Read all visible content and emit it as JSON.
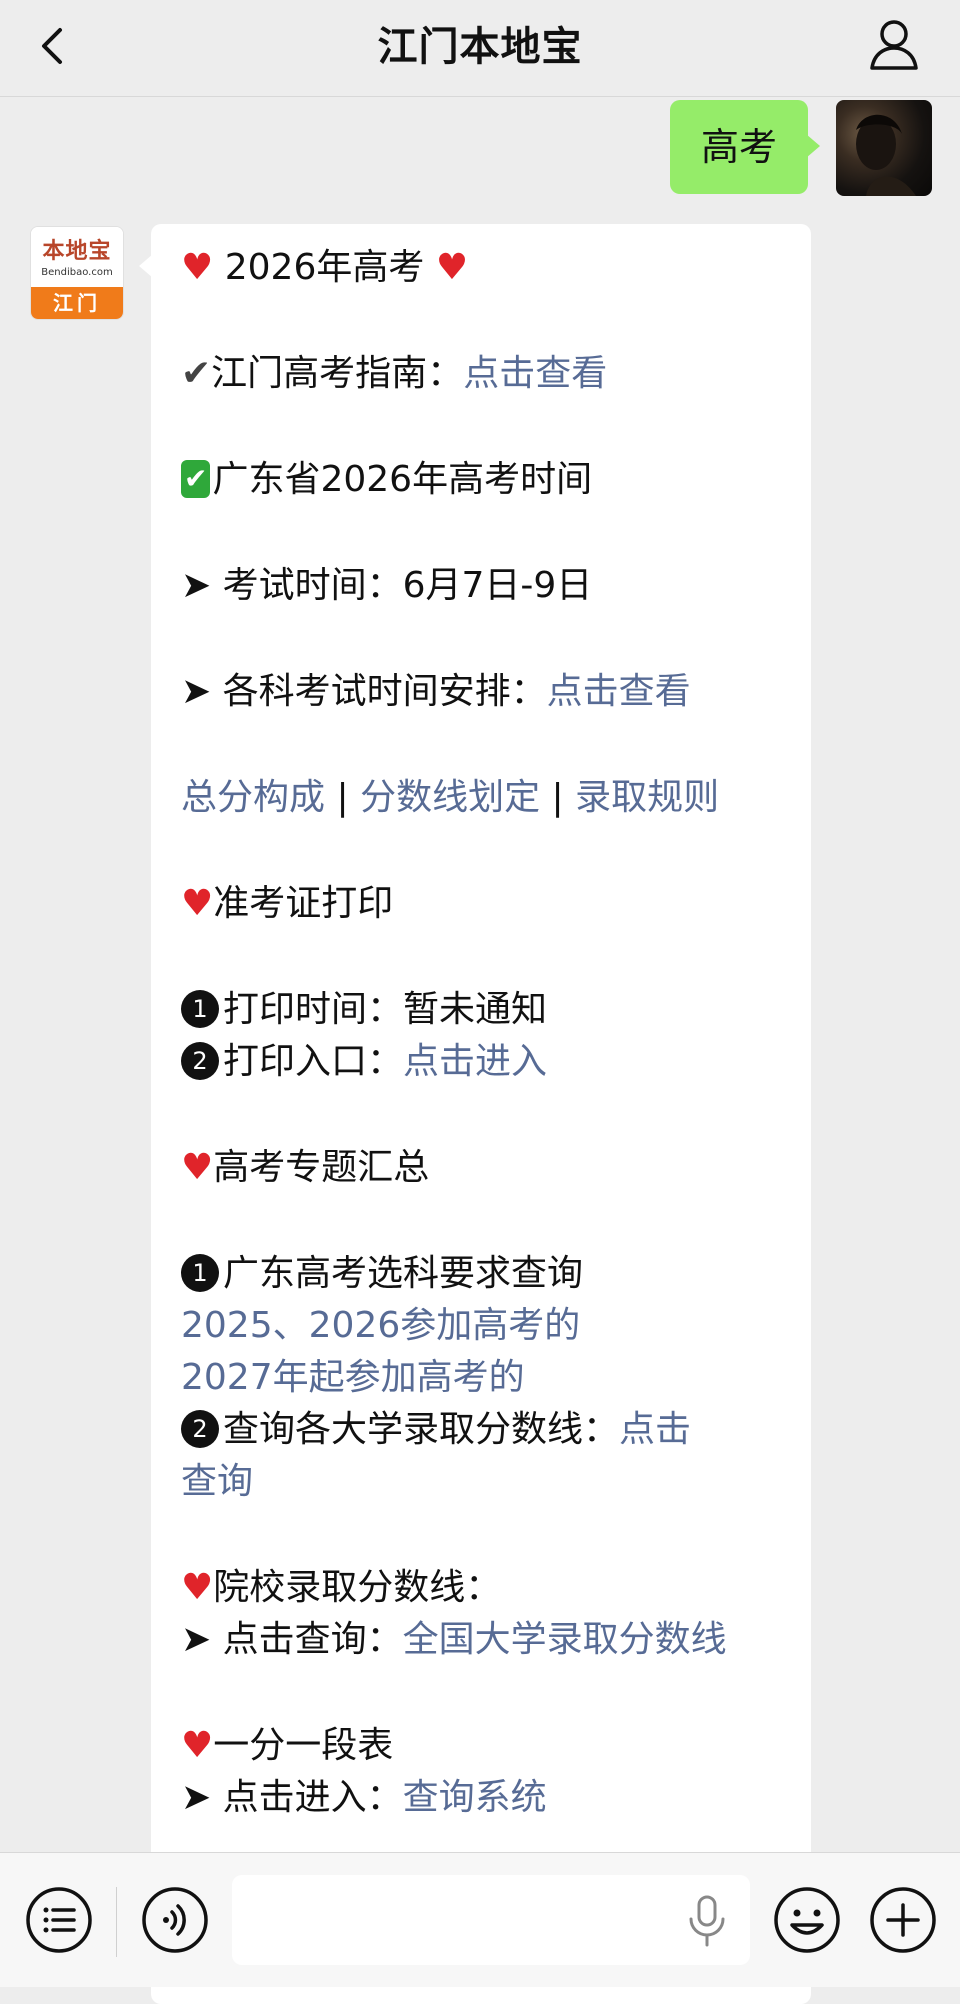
{
  "header": {
    "title": "江门本地宝",
    "back_icon": "chevron-left-icon",
    "profile_icon": "person-icon"
  },
  "outgoing": {
    "text": "高考"
  },
  "bot": {
    "avatar_brand": "本地宝",
    "avatar_sub": "Bendibao.com",
    "avatar_city": "江门"
  },
  "message": {
    "l1_text": "2026年高考",
    "l2_text": "江门高考指南：",
    "l2_link": "点击查看",
    "l3_text": "广东省2026年高考时间",
    "l4_text": "➤ 考试时间：6月7日-9日",
    "l5_text": "➤ 各科考试时间安排：",
    "l5_link": "点击查看",
    "l6_link1": "总分构成",
    "l6_link2": "分数线划定",
    "l6_link3": "录取规则",
    "l7_text": "准考证打印",
    "l8_text": "打印时间：暂未通知",
    "l9_text": "打印入口：",
    "l9_link": "点击进入",
    "l10_text": "高考专题汇总",
    "l11_text": "广东高考选科要求查询",
    "l12_link": "2025、2026参加高考的",
    "l13_link": "2027年起参加高考的",
    "l14_text": "查询各大学录取分数线：",
    "l14_link": "点击",
    "l15_link": "查询",
    "l16_text": "院校录取分数线：",
    "l17_text": "➤ 点击查询：",
    "l17_link": "全国大学录取分数线",
    "l18_text": "一分一段表",
    "l19_text": "➤ 点击进入：",
    "l19_link": "查询系统"
  },
  "inputbar": {
    "menu_icon": "list-icon",
    "voice_icon": "voice-icon",
    "mic_icon": "microphone-icon",
    "emoji_icon": "emoji-icon",
    "plus_icon": "plus-icon",
    "input_value": ""
  }
}
